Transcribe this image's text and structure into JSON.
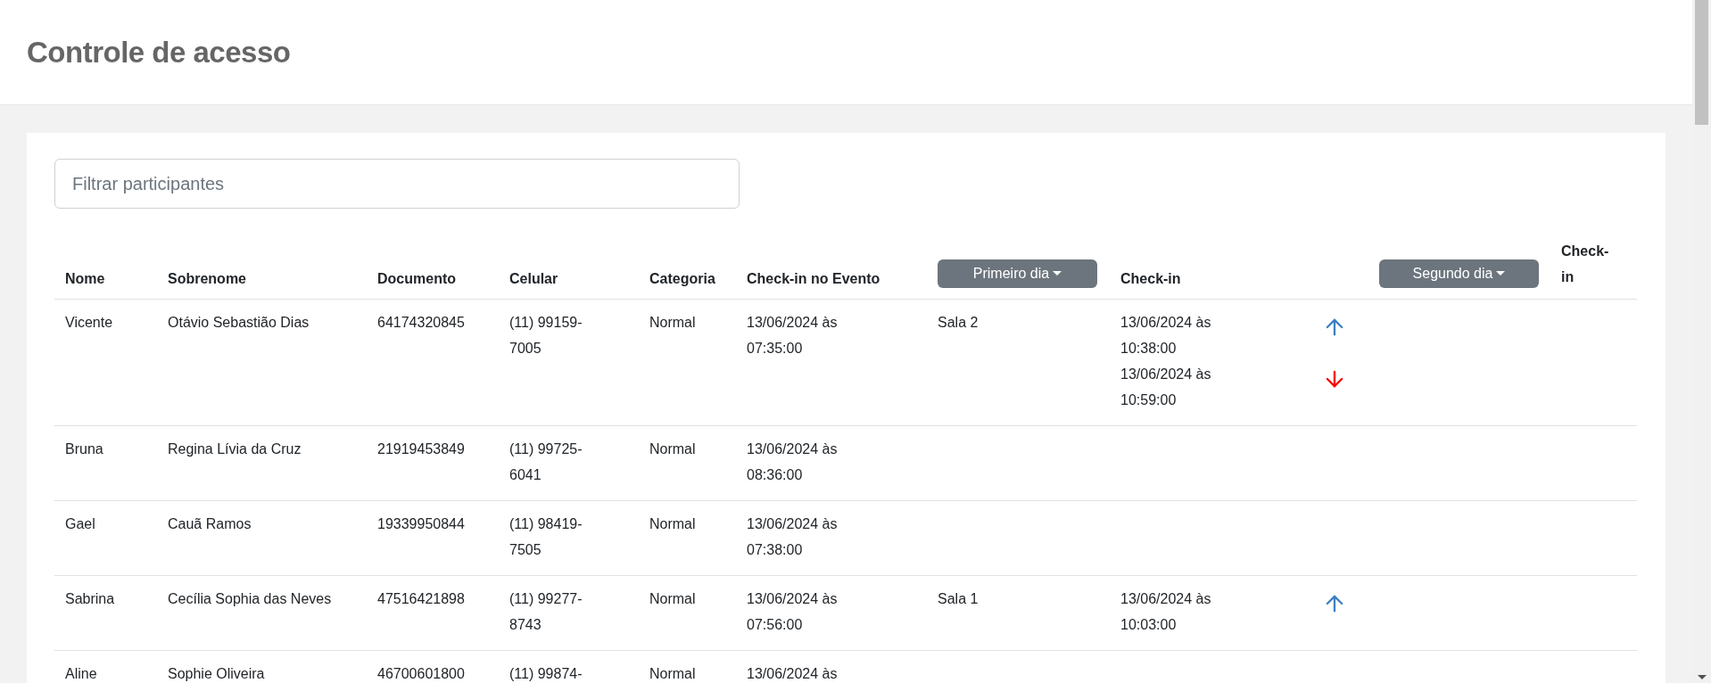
{
  "page": {
    "title": "Controle de acesso"
  },
  "filter": {
    "placeholder": "Filtrar participantes"
  },
  "table": {
    "columns": [
      {
        "kind": "text",
        "label": "Nome"
      },
      {
        "kind": "text",
        "label": "Sobrenome"
      },
      {
        "kind": "text",
        "label": "Documento"
      },
      {
        "kind": "text",
        "label": "Celular"
      },
      {
        "kind": "text",
        "label": "Categoria"
      },
      {
        "kind": "text",
        "label": "Check-in no Evento"
      },
      {
        "kind": "dropdown",
        "label": "Primeiro dia"
      },
      {
        "kind": "text",
        "label": "Check-in"
      },
      {
        "kind": "blank"
      },
      {
        "kind": "dropdown",
        "label": "Segundo dia"
      },
      {
        "kind": "narrow",
        "label": "Check-in"
      }
    ],
    "rows": [
      {
        "nome": "Vicente",
        "sobrenome": "Otávio Sebastião Dias",
        "documento": "64174320845",
        "celular": "(11) 99159-7005",
        "categoria": "Normal",
        "checkin_evento": "13/06/2024 às 07:35:00",
        "sala": "Sala 2",
        "checkins": [
          {
            "time": "13/06/2024 às 10:38:00",
            "kind": "in"
          },
          {
            "time": "13/06/2024 às 10:59:00",
            "kind": "out"
          }
        ]
      },
      {
        "nome": "Bruna",
        "sobrenome": "Regina Lívia da Cruz",
        "documento": "21919453849",
        "celular": "(11) 99725-6041",
        "categoria": "Normal",
        "checkin_evento": "13/06/2024 às 08:36:00"
      },
      {
        "nome": "Gael",
        "sobrenome": "Cauã Ramos",
        "documento": "19339950844",
        "celular": "(11) 98419-7505",
        "categoria": "Normal",
        "checkin_evento": "13/06/2024 às 07:38:00"
      },
      {
        "nome": "Sabrina",
        "sobrenome": "Cecília Sophia das Neves",
        "documento": "47516421898",
        "celular": "(11) 99277-8743",
        "categoria": "Normal",
        "checkin_evento": "13/06/2024 às 07:56:00",
        "sala": "Sala 1",
        "checkins": [
          {
            "time": "13/06/2024 às 10:03:00",
            "kind": "in"
          }
        ]
      },
      {
        "nome": "Aline",
        "sobrenome": "Sophie Oliveira",
        "documento": "46700601800",
        "celular": "(11) 99874-",
        "categoria": "Normal",
        "checkin_evento": "13/06/2024 às"
      }
    ]
  }
}
